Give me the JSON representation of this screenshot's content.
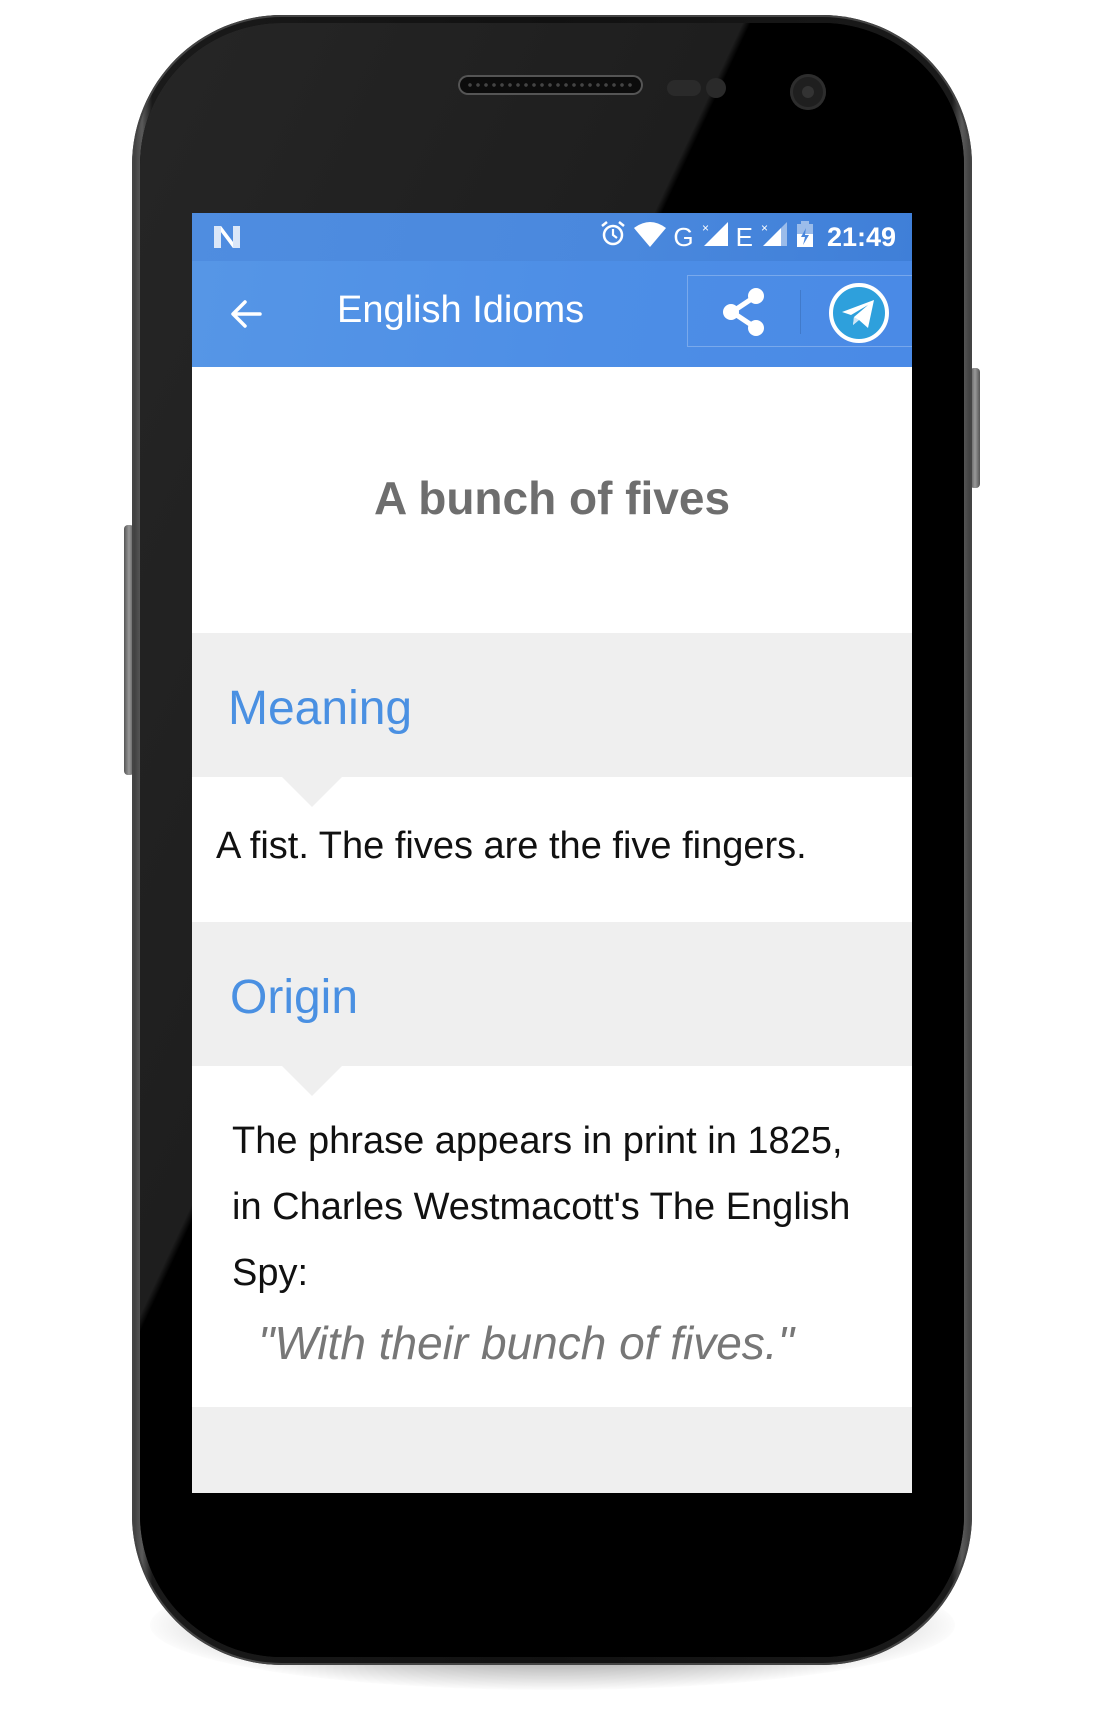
{
  "status_bar": {
    "left_icon": "n-notification-icon",
    "icons": [
      "alarm-icon",
      "wifi-icon",
      "signal-icon",
      "signal-icon",
      "battery-charging-icon"
    ],
    "network_1": "G",
    "network_2": "E",
    "time": "21:49"
  },
  "app_bar": {
    "back_icon": "arrow-left-icon",
    "title": "English Idioms",
    "actions": [
      {
        "name": "share",
        "icon": "share-icon"
      },
      {
        "name": "telegram",
        "icon": "telegram-icon"
      }
    ]
  },
  "idiom": {
    "title": "A bunch of fives"
  },
  "sections": {
    "meaning": {
      "label": "Meaning",
      "text": "A fist. The fives are the five fingers."
    },
    "origin": {
      "label": "Origin",
      "text": "The phrase appears in print in 1825, in Charles Westmacott's The English Spy:",
      "quote": "\"With their bunch of fives.\""
    }
  },
  "colors": {
    "primary": "#4a8ae6",
    "accent_text": "#4a90e2",
    "section_bg": "#efefef",
    "title_text": "#6e6e6e",
    "quote_text": "#777777"
  }
}
